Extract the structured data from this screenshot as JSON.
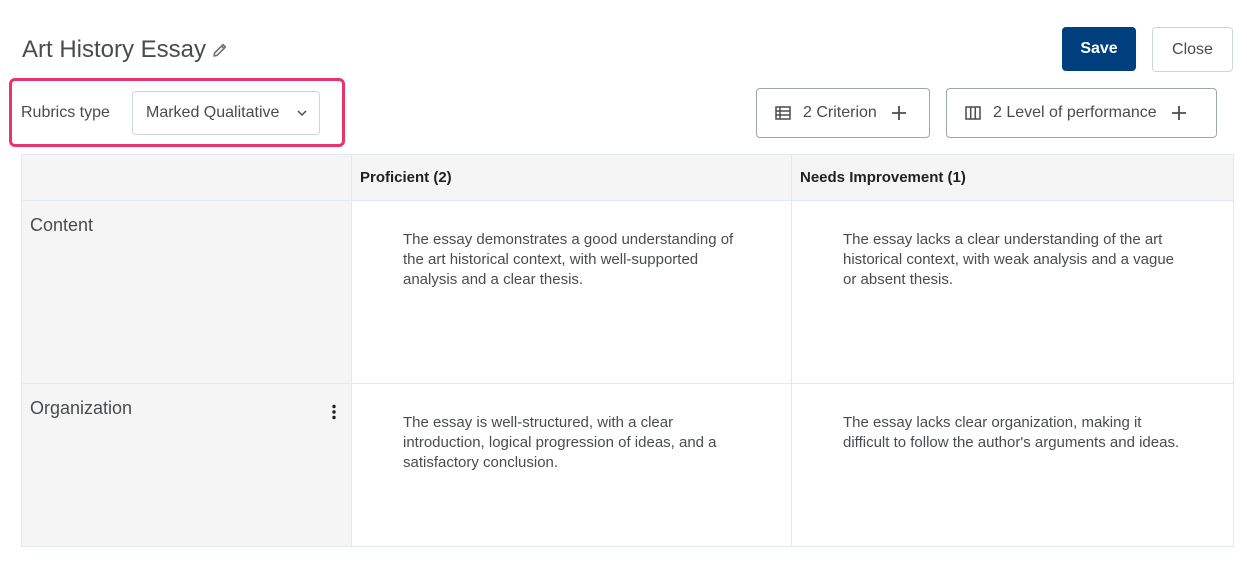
{
  "header": {
    "title": "Art History Essay",
    "save_label": "Save",
    "close_label": "Close"
  },
  "rubrics_type": {
    "label": "Rubrics type",
    "selected": "Marked Qualitative"
  },
  "toolbar": {
    "criterion_label": "2 Criterion",
    "levels_label": "2 Level of performance"
  },
  "table": {
    "columns": [
      "",
      "Proficient (2)",
      "Needs Improvement (1)"
    ],
    "rows": [
      {
        "criterion": "Content",
        "cells": [
          "The essay demonstrates a good understanding of the art historical context, with well-supported analysis and a clear thesis.",
          "The essay lacks a clear understanding of the art historical context, with weak analysis and a vague or absent thesis."
        ]
      },
      {
        "criterion": "Organization",
        "cells": [
          "The essay is well-structured, with a clear introduction, logical progression of ideas, and a satisfactory conclusion.",
          "The essay lacks clear organization, making it difficult to follow the author's arguments and ideas."
        ]
      }
    ]
  },
  "icons": {
    "edit": "pencil-icon",
    "dropdown": "chevron-down-icon",
    "criterion": "list-icon",
    "levels": "columns-icon",
    "add": "plus-icon",
    "more": "kebab-icon"
  },
  "colors": {
    "primary": "#003f7d",
    "highlight": "#e8336b",
    "header_bg": "#f5f5f5"
  }
}
